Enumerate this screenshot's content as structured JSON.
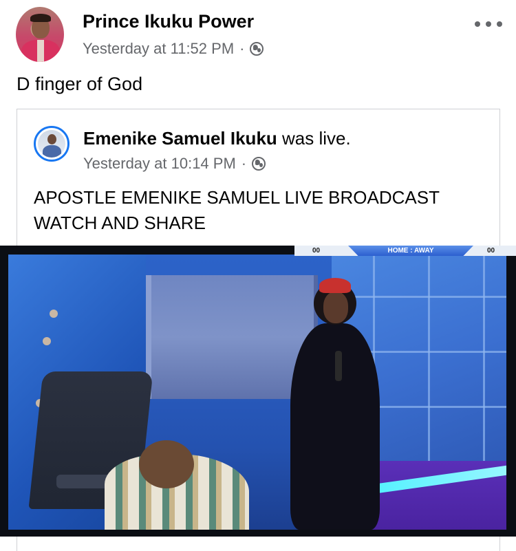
{
  "post": {
    "author": "Prince Ikuku Power",
    "time": "Yesterday at 11:52 PM",
    "separator": "·",
    "audience_icon": "globe-icon",
    "more_icon": "more-horizontal-icon",
    "text": "D finger of God"
  },
  "shared": {
    "author": "Emenike Samuel Ikuku",
    "action": " was live.",
    "time": "Yesterday at 10:14 PM",
    "separator": "·",
    "audience_icon": "globe-icon",
    "text_line1": "APOSTLE EMENIKE SAMUEL LIVE BROADCAST",
    "text_line2": "WATCH AND SHARE"
  },
  "video": {
    "score_left": "00",
    "banner": "HOME : AWAY",
    "score_right": "00"
  },
  "colors": {
    "link_blue": "#1877f2",
    "meta_gray": "#65676b",
    "text": "#050505",
    "border": "#ced0d4"
  }
}
